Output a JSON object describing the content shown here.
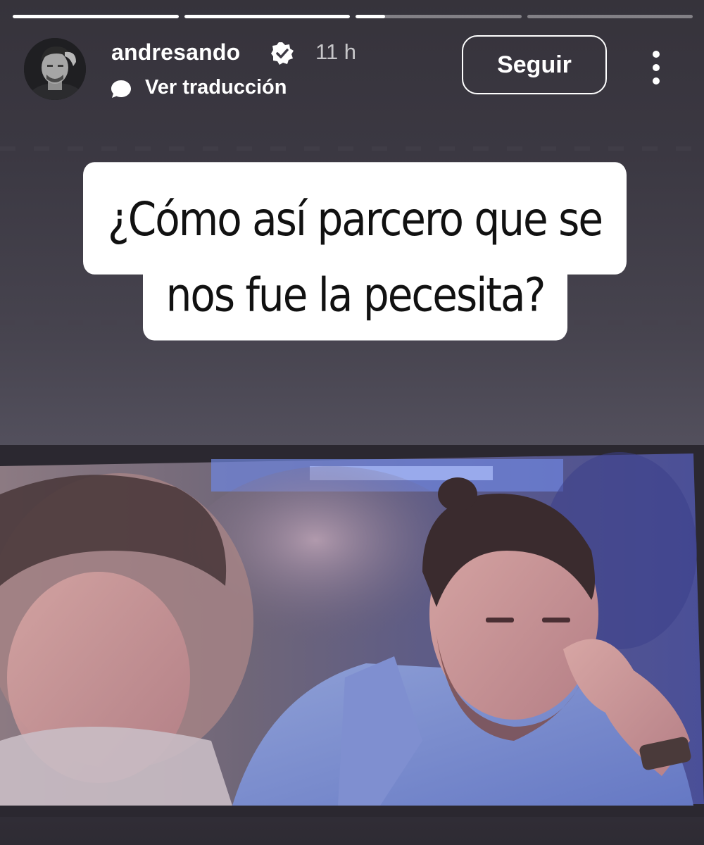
{
  "story": {
    "progress_segments": [
      {
        "progress": 1.0
      },
      {
        "progress": 1.0
      },
      {
        "progress": 0.18
      },
      {
        "progress": 0.0
      }
    ]
  },
  "header": {
    "username": "andresando",
    "verified_icon": "verified-badge-icon",
    "time_ago": "11 h",
    "translate_label": "Ver traducción",
    "follow_label": "Seguir",
    "more_icon": "more-vertical-icon"
  },
  "caption": {
    "line1": "¿Cómo así parcero que se",
    "line2": "nos fue la pecesita?"
  },
  "colors": {
    "background": "#3d3a44",
    "caption_bg": "#ffffff",
    "caption_text": "#111111",
    "progress_active": "#ffffff",
    "progress_inactive": "rgba(255,255,255,0.38)"
  }
}
